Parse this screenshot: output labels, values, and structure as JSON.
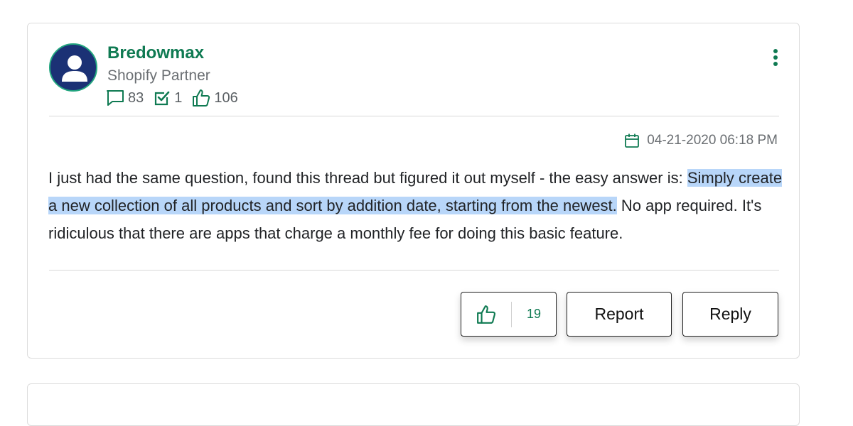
{
  "post": {
    "author": {
      "username": "Bredowmax",
      "role": "Shopify Partner",
      "stats": {
        "messages": "83",
        "solutions": "1",
        "likes": "106"
      }
    },
    "date": "04-21-2020 06:18 PM",
    "body": {
      "before_highlight": "I just had the same question, found this thread but figured it out myself - the easy answer is: ",
      "highlight": "Simply create a new collection of all products and sort by addition date, starting from the newest.",
      "after_highlight": " No app required. It's ridiculous that there are apps that charge a monthly fee for doing this basic feature."
    },
    "actions": {
      "like_count": "19",
      "report_label": "Report",
      "reply_label": "Reply"
    }
  },
  "colors": {
    "accent": "#0f7a52",
    "avatar_bg": "#1b3175",
    "highlight": "#b8d6f9"
  },
  "icons": [
    "user-avatar-icon",
    "message-icon",
    "solution-check-icon",
    "thumbs-up-icon",
    "calendar-icon",
    "more-options-icon"
  ]
}
